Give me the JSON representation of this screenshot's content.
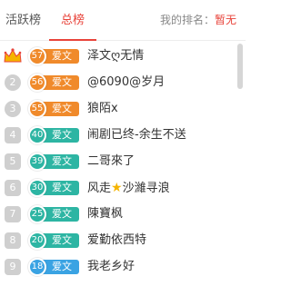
{
  "tabs": [
    {
      "label": "活跃榜"
    },
    {
      "label": "总榜"
    }
  ],
  "myrank": {
    "label": "我的排名：",
    "value": "暂无"
  },
  "colors": {
    "accent": "#e8433a",
    "orange": "#f08a2b",
    "teal": "#2db5a3",
    "blue": "#3aa3e3"
  },
  "list": [
    {
      "rank": "1",
      "level": "57",
      "tag": "爱文",
      "name": "泽文ღ无情",
      "color": "orange",
      "icon": "crown-icon"
    },
    {
      "rank": "2",
      "level": "56",
      "tag": "爱文",
      "name": "@6090@岁月",
      "color": "orange"
    },
    {
      "rank": "3",
      "level": "55",
      "tag": "爱文",
      "name": "狼陌x",
      "color": "orange"
    },
    {
      "rank": "4",
      "level": "40",
      "tag": "爱文",
      "name": "闹剧已终-余生不送",
      "color": "teal"
    },
    {
      "rank": "5",
      "level": "39",
      "tag": "爱文",
      "name": "二哥來了",
      "color": "teal"
    },
    {
      "rank": "6",
      "level": "30",
      "tag": "爱文",
      "name_pre": "风走",
      "name_post": "沙濰寻浪",
      "color": "teal",
      "star": "★"
    },
    {
      "rank": "7",
      "level": "25",
      "tag": "爱文",
      "name": "陳寶枫",
      "color": "teal"
    },
    {
      "rank": "8",
      "level": "20",
      "tag": "爱文",
      "name": "爱勤依西特",
      "color": "teal"
    },
    {
      "rank": "9",
      "level": "18",
      "tag": "爱文",
      "name": "我老乡好",
      "color": "blue"
    }
  ]
}
